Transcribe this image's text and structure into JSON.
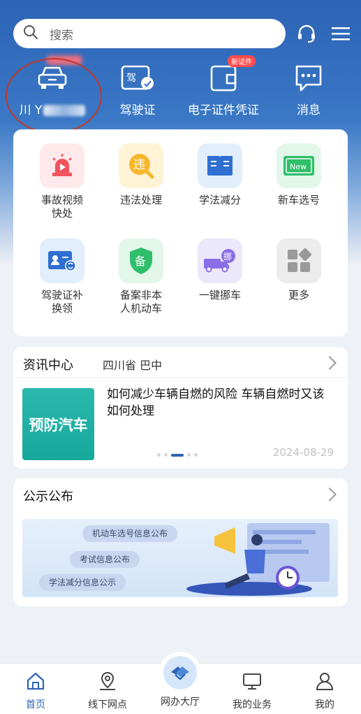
{
  "search": {
    "placeholder": "搜索"
  },
  "header_icons": [
    "headset-icon",
    "menu-icon"
  ],
  "quick_links": [
    {
      "label": "川 Y",
      "icon": "car-icon",
      "masked": true
    },
    {
      "label": "驾驶证",
      "icon": "license-icon"
    },
    {
      "label": "电子证件凭证",
      "icon": "wallet-icon",
      "badge": "新证件"
    },
    {
      "label": "消息",
      "icon": "message-icon"
    }
  ],
  "services": [
    {
      "label": "事故视频\n快处",
      "icon": "alarm-icon"
    },
    {
      "label": "违法处理",
      "icon": "violation-icon",
      "icon_text": "违"
    },
    {
      "label": "学法减分",
      "icon": "book-icon"
    },
    {
      "label": "新车选号",
      "icon": "new-plate-icon",
      "icon_text": "New"
    },
    {
      "label": "驾驶证补\n换领",
      "icon": "id-card-icon"
    },
    {
      "label": "备案非本\n人机动车",
      "icon": "shield-icon",
      "icon_text": "备"
    },
    {
      "label": "一键挪车",
      "icon": "truck-icon",
      "icon_text": "挪"
    },
    {
      "label": "更多",
      "icon": "more-icon"
    }
  ],
  "news": {
    "title": "资讯中心",
    "location": "四川省 巴中",
    "thumb_text": "预防汽车",
    "headline": "如何减少车辆自燃的风险 车辆自燃时又该如何处理",
    "date": "2024-08-29"
  },
  "notice": {
    "title": "公示公布",
    "pills": [
      "机动车选号信息公布",
      "考试信息公布",
      "学法减分信息公示"
    ]
  },
  "tabs": [
    {
      "label": "首页",
      "icon": "home-icon",
      "active": true
    },
    {
      "label": "线下网点",
      "icon": "location-icon"
    },
    {
      "label": "网办大厅",
      "icon": "hall-icon"
    },
    {
      "label": "我的业务",
      "icon": "monitor-icon"
    },
    {
      "label": "我的",
      "icon": "user-icon"
    }
  ],
  "colors": {
    "primary": "#2d63b5",
    "badge": "#ff4d4f",
    "annotation": "#c0392b"
  }
}
